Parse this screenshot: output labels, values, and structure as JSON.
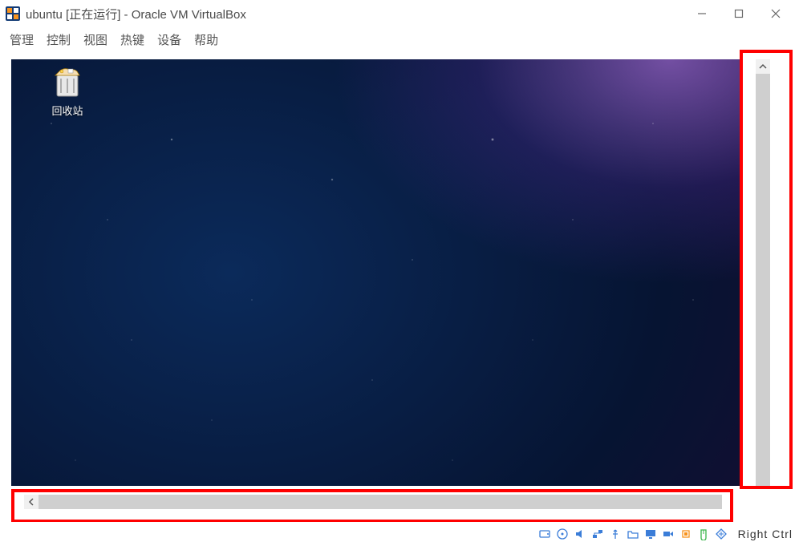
{
  "titlebar": {
    "title": "ubuntu [正在运行] - Oracle VM VirtualBox"
  },
  "menubar": {
    "items": [
      {
        "label": "管理"
      },
      {
        "label": "控制"
      },
      {
        "label": "视图"
      },
      {
        "label": "热键"
      },
      {
        "label": "设备"
      },
      {
        "label": "帮助"
      }
    ]
  },
  "guest": {
    "desktop_icons": [
      {
        "id": "recycle-bin",
        "label": "回收站"
      }
    ]
  },
  "statusbar": {
    "host_key": "Right Ctrl",
    "indicators": [
      "hard-disk",
      "optical-disk",
      "audio",
      "network",
      "usb",
      "shared-folders",
      "display",
      "recording",
      "cpu",
      "clipboard",
      "drag-drop",
      "mouse-integration"
    ]
  },
  "annotations": {
    "highlight_vertical_scrollbar": true,
    "highlight_horizontal_scrollbar": true,
    "color": "#ff0000"
  }
}
